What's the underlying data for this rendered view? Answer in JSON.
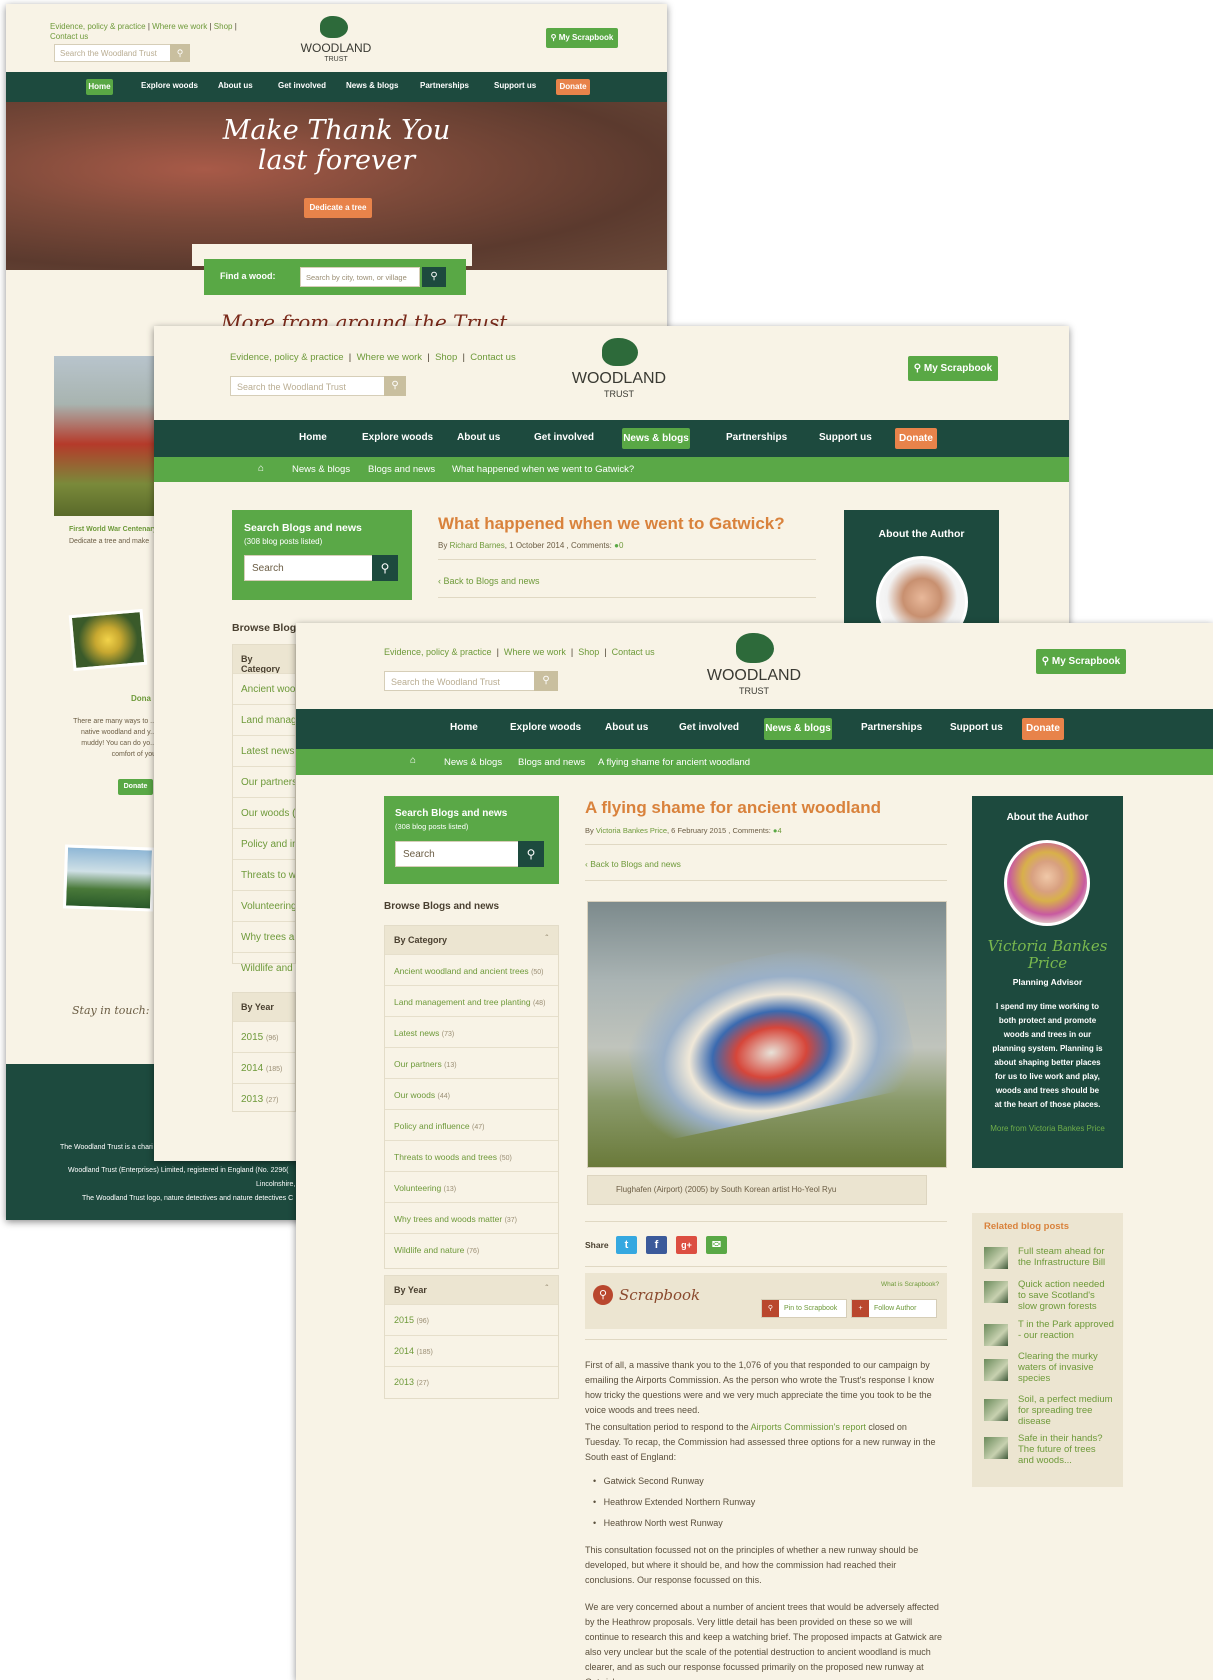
{
  "site": {
    "logo_line1": "WOODLAND",
    "logo_line2": "TRUST",
    "top_links": [
      "Evidence, policy & practice",
      "Where we work",
      "Shop",
      "Contact us"
    ],
    "search_placeholder": "Search the Woodland Trust",
    "scrapbook_button": "My Scrapbook",
    "nav": [
      "Home",
      "Explore woods",
      "About us",
      "Get involved",
      "News & blogs",
      "Partnerships",
      "Support us",
      "Donate"
    ]
  },
  "window1": {
    "hero_line1": "Make Thank You",
    "hero_line2": "last forever",
    "hero_button": "Dedicate a tree",
    "find_label": "Find a wood:",
    "find_placeholder": "Search by city, town, or village",
    "section_heading": "More from around the Trust",
    "card1_title": "First World War Centenary",
    "card1_text": "Dedicate a tree and make",
    "card2_title": "Dona",
    "card2_text": "There are many ways to ... native woodland and y... muddy! You can do yo... comfort of you",
    "card2_button": "Donate",
    "stay_in_touch": "Stay in touch:",
    "footer1": "The Woodland Trust is a chari",
    "footer2": "Woodland Trust (Enterprises) Limited, registered in England (No. 2296(",
    "footer3": "Lincolnshire,",
    "footer4": "The Woodland Trust logo, nature detectives and nature detectives C"
  },
  "window2": {
    "breadcrumb": [
      "News & blogs",
      "Blogs and news",
      "What happened when we went to Gatwick?"
    ],
    "search_title": "Search Blogs and news",
    "search_sub": "(308 blog posts listed)",
    "search_placeholder": "Search",
    "browse_heading": "Browse Blogs a",
    "by_category": "By Category",
    "categories": [
      "Ancient wood",
      "Land manage",
      "Latest news (",
      "Our partners",
      "Our woods (4",
      "Policy and inf",
      "Threats to wo",
      "Volunteering (",
      "Why trees an",
      "Wildlife and n"
    ],
    "by_year": "By Year",
    "years": [
      [
        "2015",
        "(96)"
      ],
      [
        "2014",
        "(185)"
      ],
      [
        "2013",
        "(27)"
      ]
    ],
    "post_title": "What happened when we went to Gatwick?",
    "post_by": "By",
    "post_author": "Richard Barnes",
    "post_date": ", 1 October 2014 , Comments:",
    "post_comments": "0",
    "back_link": "Back to Blogs and news",
    "about_author": "About the Author"
  },
  "window3": {
    "breadcrumb": [
      "News & blogs",
      "Blogs and news",
      "A flying shame for ancient woodland"
    ],
    "search_title": "Search Blogs and news",
    "search_sub": "(308 blog posts listed)",
    "search_placeholder": "Search",
    "browse_heading": "Browse Blogs and news",
    "by_category": "By Category",
    "categories": [
      [
        "Ancient woodland and ancient trees",
        "(50)"
      ],
      [
        "Land management and tree planting",
        "(48)"
      ],
      [
        "Latest news",
        "(73)"
      ],
      [
        "Our partners",
        "(13)"
      ],
      [
        "Our woods",
        "(44)"
      ],
      [
        "Policy and influence",
        "(47)"
      ],
      [
        "Threats to woods and trees",
        "(50)"
      ],
      [
        "Volunteering",
        "(13)"
      ],
      [
        "Why trees and woods matter",
        "(37)"
      ],
      [
        "Wildlife and nature",
        "(76)"
      ]
    ],
    "by_year": "By Year",
    "years": [
      [
        "2015",
        "(96)"
      ],
      [
        "2014",
        "(185)"
      ],
      [
        "2013",
        "(27)"
      ]
    ],
    "post_title": "A flying shame for ancient woodland",
    "post_by": "By",
    "post_author": "Victoria Bankes Price",
    "post_date": ", 6 February 2015 , Comments:",
    "post_comments": "4",
    "back_link": "Back to Blogs and news",
    "caption": "Flughafen (Airport) (2005) by South Korean artist Ho-Yeol Ryu",
    "share_label": "Share",
    "scrapbook_title": "Scrapbook",
    "scrapbook_what": "What is Scrapbook?",
    "pin_button": "Pin to Scrapbook",
    "follow_button": "Follow Author",
    "para1_a": "First of all, a massive thank you to the 1,076 of you that responded to our campaign by emailing the Airports Commission. As the person who wrote the Trust's response I know how tricky the questions were and we very much appreciate the time you took to be the voice woods and trees need.",
    "para2_a": "The consultation period to respond to the",
    "para2_link": "Airports Commission's report",
    "para2_b": "closed on Tuesday. To recap, the Commission had assessed three options for a new runway in the South east of England:",
    "bullets": [
      "Gatwick Second Runway",
      "Heathrow Extended Northern Runway",
      "Heathrow North west Runway"
    ],
    "para3": "This consultation focussed not on the principles of whether a new runway should be developed, but where it should be, and how the commission had reached their conclusions. Our response focussed on this.",
    "para4": "We are very concerned about a number of ancient trees that would be adversely affected by the Heathrow proposals. Very little detail has been provided on these so we will continue to research this and keep a watching brief. The proposed impacts at Gatwick are also very unclear but the scale of the potential destruction to ancient woodland is much clearer, and as such our response focussed primarily on the proposed new runway at Gatwick.",
    "about_author": "About the Author",
    "author_name_1": "Victoria Bankes",
    "author_name_2": "Price",
    "author_role": "Planning Advisor",
    "author_bio": "I spend my time working to both protect and promote woods and trees in our planning system. Planning is about shaping better places for us to live work and play, woods and trees should be at the heart of those places.",
    "author_more": "More from Victoria Bankes Price",
    "related_heading": "Related blog posts",
    "related": [
      "Full steam ahead for the Infrastructure Bill",
      "Quick action needed to save Scotland's slow grown forests",
      "T in the Park approved - our reaction",
      "Clearing the murky waters of invasive species",
      "Soil, a perfect medium for spreading tree disease",
      "Safe in their hands? The future of trees and woods..."
    ]
  }
}
